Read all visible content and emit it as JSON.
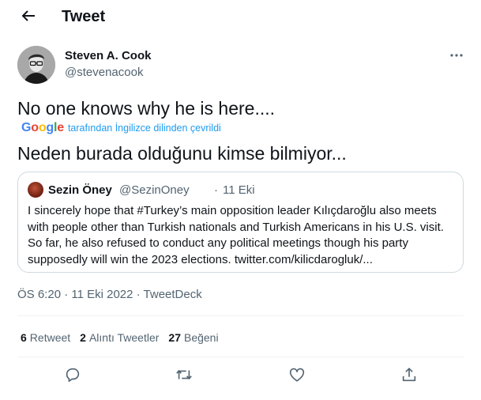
{
  "header": {
    "title": "Tweet"
  },
  "author": {
    "name": "Steven A. Cook",
    "handle": "@stevenacook"
  },
  "tweet": {
    "text": "No one knows why he is here....",
    "translation_provider": "Google",
    "translation_label": "tarafından İngilizce dilinden çevrildi",
    "translated_text": "Neden burada olduğunu kimse bilmiyor..."
  },
  "quote": {
    "name": "Sezin Öney",
    "handle": "@SezinOney",
    "separator": "·",
    "date": "11 Eki",
    "text": "I sincerely hope that #Turkey’s main opposition leader Kılıçdaroğlu also meets with people other than Turkish nationals and Turkish Americans in his U.S. visit. So far, he also refused to conduct any political meetings though his party supposedly will win the 2023 elections. twitter.com/kilicdarogluk/..."
  },
  "meta": {
    "timestamp": "ÖS 6:20 · 11 Eki 2022 · TweetDeck"
  },
  "stats": [
    {
      "count": "6",
      "label": "Retweet"
    },
    {
      "count": "2",
      "label": "Alıntı Tweetler"
    },
    {
      "count": "27",
      "label": "Beğeni"
    }
  ],
  "icons": {
    "back": "arrow-left-icon",
    "more": "more-icon",
    "reply": "reply-icon",
    "retweet": "retweet-icon",
    "like": "heart-icon",
    "share": "share-icon"
  },
  "colors": {
    "text": "#0f1419",
    "secondary": "#536471",
    "link": "#1d9bf0",
    "border": "#cfd9de"
  }
}
